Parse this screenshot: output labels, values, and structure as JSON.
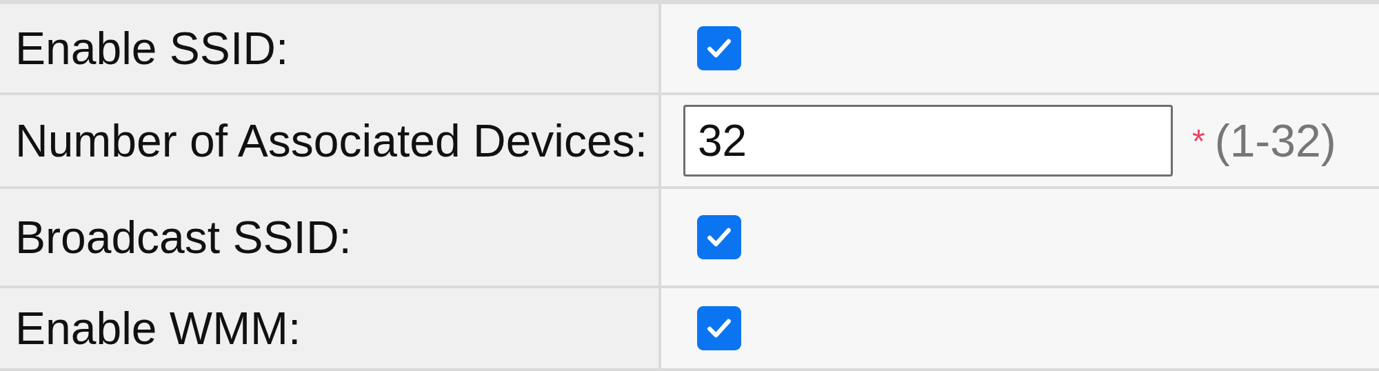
{
  "rows": [
    {
      "kind": "checkbox",
      "label": "Enable SSID:",
      "checked": true
    },
    {
      "kind": "number",
      "label": "Number of Associated Devices:",
      "value": "32",
      "required_mark": "*",
      "hint": "(1-32)"
    },
    {
      "kind": "checkbox",
      "label": "Broadcast SSID:",
      "checked": true
    },
    {
      "kind": "checkbox",
      "label": "Enable WMM:",
      "checked": true
    }
  ]
}
